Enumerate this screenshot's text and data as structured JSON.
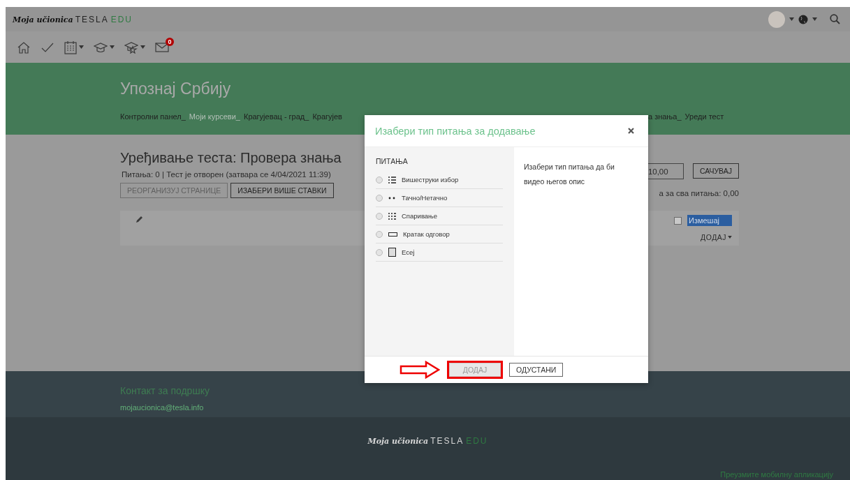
{
  "topbar": {
    "logo": {
      "script": "Moja učionica",
      "word": "TESLA",
      "suffix": "EDU"
    }
  },
  "toolbar": {
    "items": [
      {
        "kind": "home",
        "caret": false
      },
      {
        "kind": "check",
        "caret": false
      },
      {
        "kind": "calendar",
        "caret": true
      },
      {
        "kind": "cap",
        "caret": true
      },
      {
        "kind": "cap-star",
        "caret": true
      },
      {
        "kind": "mail",
        "caret": false,
        "badge": "0"
      }
    ]
  },
  "header": {
    "title": "Упознај Србију",
    "breadcrumbs": [
      {
        "label": "Контролни панел_",
        "muted": false
      },
      {
        "label": "Моји курсеви_",
        "muted": true
      },
      {
        "label": "Крагујевац - град_",
        "muted": false
      },
      {
        "label": "Крагујев",
        "muted": false
      },
      {
        "label": "а знања_",
        "muted": false
      },
      {
        "label": "Уреди тест",
        "muted": false
      }
    ]
  },
  "page": {
    "heading": "Уређивање теста: Провера знања",
    "summary": "Питања: 0 | Тест је отворен (затвара се 4/04/2021 11:39)",
    "buttons": [
      {
        "label": "РЕОРГАНИЗУЈ СТРАНИЦЕ",
        "disabled": true
      },
      {
        "label": "ИЗАБЕРИ ВИШЕ СТАВКИ",
        "disabled": false
      }
    ],
    "max_grade": {
      "value": "10,00"
    },
    "save": "САЧУВАЈ",
    "total": "а за сва питања: 0,00",
    "shuffle": {
      "label": "Измешај",
      "checked": false
    },
    "add": "ДОДАЈ"
  },
  "modal": {
    "title": "Изабери тип питања за додавање",
    "section": "ПИТАЊА",
    "options": [
      {
        "label": "Вишеструки избор",
        "kind": "list",
        "selected": false
      },
      {
        "label": "Тачно/Нетачно",
        "kind": "dots",
        "selected": false
      },
      {
        "label": "Спаривање",
        "kind": "grid",
        "selected": false
      },
      {
        "label": "Кратак одговор",
        "kind": "line",
        "selected": false
      },
      {
        "label": "Есеј",
        "kind": "page",
        "selected": false
      }
    ],
    "description": "Изабери тип питања да би видео његов опис",
    "buttons": [
      {
        "label": "ДОДАЈ",
        "disabled": true,
        "highlighted": true
      },
      {
        "label": "ОДУСТАНИ",
        "disabled": false,
        "highlighted": false
      }
    ]
  },
  "footer": {
    "contact_title": "Контакт за подршку",
    "email": "mojaucionica@tesla.info",
    "logo": {
      "script": "Moja učionica",
      "word": "TESLA",
      "suffix": "EDU"
    },
    "app_link": "Преузмите мобилну апликацију"
  }
}
